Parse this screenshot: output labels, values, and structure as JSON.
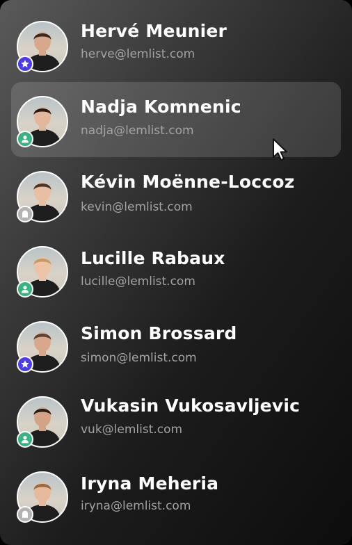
{
  "users": [
    {
      "name": "Hervé Meunier",
      "email": "herve@lemlist.com",
      "role_icon": "star-icon",
      "role_color": "#4b3cf0",
      "skin": "#d9a88a",
      "hair": "#3a2a20",
      "shirt": "#1e1e1e"
    },
    {
      "name": "Nadja Komnenic",
      "email": "nadja@lemlist.com",
      "role_icon": "user-icon",
      "role_color": "#36b37e",
      "skin": "#e2b79c",
      "hair": "#2a1b14",
      "shirt": "#1e1e1e"
    },
    {
      "name": "Kévin Moënne-Loccoz",
      "email": "kevin@lemlist.com",
      "role_icon": "ghost-icon",
      "role_color": "#b3b3b3",
      "skin": "#e8bfa3",
      "hair": "#4a3526",
      "shirt": "#1e1e1e"
    },
    {
      "name": "Lucille Rabaux",
      "email": "lucille@lemlist.com",
      "role_icon": "user-icon",
      "role_color": "#36b37e",
      "skin": "#ecc3a4",
      "hair": "#c89a62",
      "shirt": "#1e1e1e"
    },
    {
      "name": "Simon Brossard",
      "email": "simon@lemlist.com",
      "role_icon": "star-icon",
      "role_color": "#4b3cf0",
      "skin": "#d9a88a",
      "hair": "#5b4030",
      "shirt": "#1e1e1e"
    },
    {
      "name": "Vukasin Vukosavljevic",
      "email": "vuk@lemlist.com",
      "role_icon": "user-icon",
      "role_color": "#36b37e",
      "skin": "#d4a284",
      "hair": "#2a1d16",
      "shirt": "#1e1e1e"
    },
    {
      "name": "Iryna Meheria",
      "email": "iryna@lemlist.com",
      "role_icon": "ghost-icon",
      "role_color": "#b3b3b3",
      "skin": "#e6b99b",
      "hair": "#9a6a3e",
      "shirt": "#1e1e1e"
    }
  ],
  "highlighted_index": 1,
  "colors": {
    "name_text": "#ffffff",
    "email_text": "#a3a3a3",
    "highlight": "rgba(255,255,255,0.14)"
  }
}
